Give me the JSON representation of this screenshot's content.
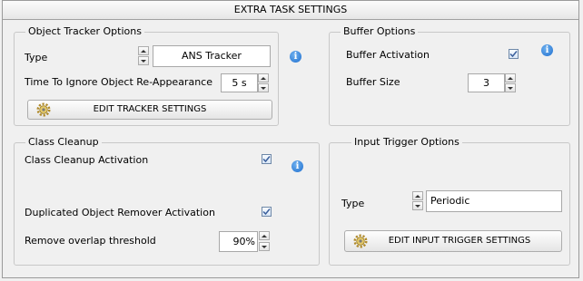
{
  "title": "EXTRA TASK SETTINGS",
  "object_tracker": {
    "group_title": "Object Tracker Options",
    "type_label": "Type",
    "type_value": "ANS Tracker",
    "ignore_label": "Time To Ignore Object Re-Appearance",
    "ignore_value": "5 s",
    "edit_button": "EDIT TRACKER SETTINGS",
    "info_glyph": "i"
  },
  "buffer": {
    "group_title": "Buffer Options",
    "activation_label": "Buffer Activation",
    "activation_checked": true,
    "size_label": "Buffer Size",
    "size_value": "3",
    "info_glyph": "i"
  },
  "class_cleanup": {
    "group_title": "Class Cleanup",
    "activation_label": "Class Cleanup Activation",
    "activation_checked": true,
    "dup_label": "Duplicated Object Remover Activation",
    "dup_checked": true,
    "overlap_label": "Remove overlap threshold",
    "overlap_value": "90%",
    "info_glyph": "i"
  },
  "input_trigger": {
    "group_title": "Input Trigger Options",
    "type_label": "Type",
    "type_value": "Periodic",
    "edit_button": "EDIT INPUT TRIGGER SETTINGS"
  },
  "icons": {
    "gear": "gear-icon",
    "info": "info-icon",
    "check": "checkmark-icon"
  },
  "colors": {
    "check": "#3a5f9c",
    "info": "#1f6fcf"
  }
}
